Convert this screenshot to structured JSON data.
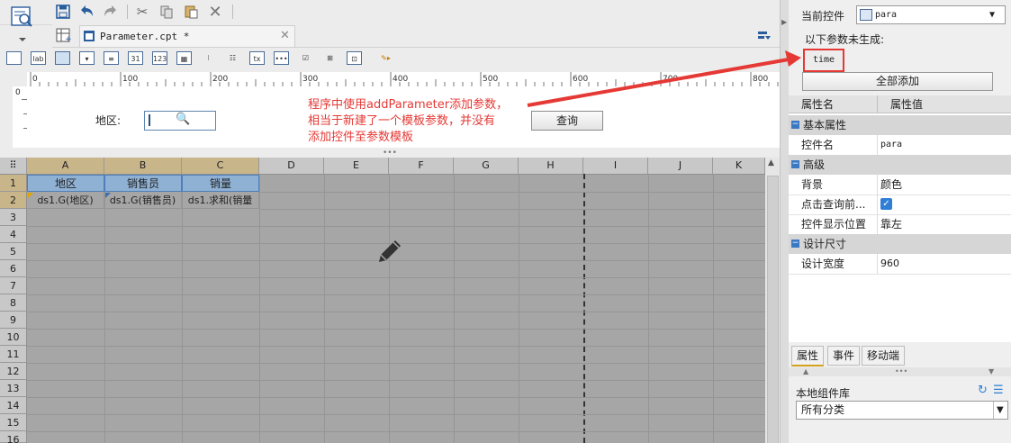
{
  "file_tab": {
    "title": "Parameter.cpt *"
  },
  "ruler": {
    "labels": [
      "0",
      "100",
      "200",
      "300",
      "400",
      "500",
      "600",
      "700",
      "800"
    ]
  },
  "vruler": {
    "label": "0"
  },
  "param_form": {
    "area_label": "地区:",
    "query_button": "查询"
  },
  "annotation": {
    "lines": [
      "程序中使用addParameter添加参数，",
      "相当于新建了一个模板参数，并没有",
      "添加控件至参数模板"
    ]
  },
  "grid": {
    "columns": [
      "A",
      "B",
      "C",
      "D",
      "E",
      "F",
      "G",
      "H",
      "I",
      "J",
      "K"
    ],
    "rows": [
      "1",
      "2",
      "3",
      "4",
      "5",
      "6",
      "7",
      "8",
      "9",
      "10",
      "11",
      "12",
      "13",
      "14",
      "15",
      "16"
    ],
    "row1": [
      "地区",
      "销售员",
      "销量"
    ],
    "row2": [
      "ds1.G(地区)",
      "ds1.G(销售员)",
      "ds1.求和(销量"
    ]
  },
  "right_panel": {
    "current_control_label": "当前控件",
    "current_control_value": "para",
    "unbuilt_label": "以下参数未生成:",
    "unbuilt_param": "time",
    "add_all_button": "全部添加",
    "table_headers": [
      "属性名",
      "属性值"
    ],
    "groups": [
      {
        "title": "基本属性",
        "rows": [
          {
            "k": "控件名",
            "v": "para"
          }
        ]
      },
      {
        "title": "高级",
        "rows": [
          {
            "k": "背景",
            "v": "颜色"
          },
          {
            "k": "点击查询前...",
            "v": "",
            "checked": true
          },
          {
            "k": "控件显示位置",
            "v": "靠左"
          }
        ]
      },
      {
        "title": "设计尺寸",
        "rows": [
          {
            "k": "设计宽度",
            "v": "960"
          }
        ]
      }
    ],
    "tabs": [
      "属性",
      "事件",
      "移动端"
    ],
    "library_label": "本地组件库",
    "library_select": "所有分类"
  },
  "colors": {
    "accent": "#2a5d9e",
    "annotation": "#e53935",
    "selected_header": "#c9b58a",
    "selected_cell": "#8fb1d4"
  }
}
